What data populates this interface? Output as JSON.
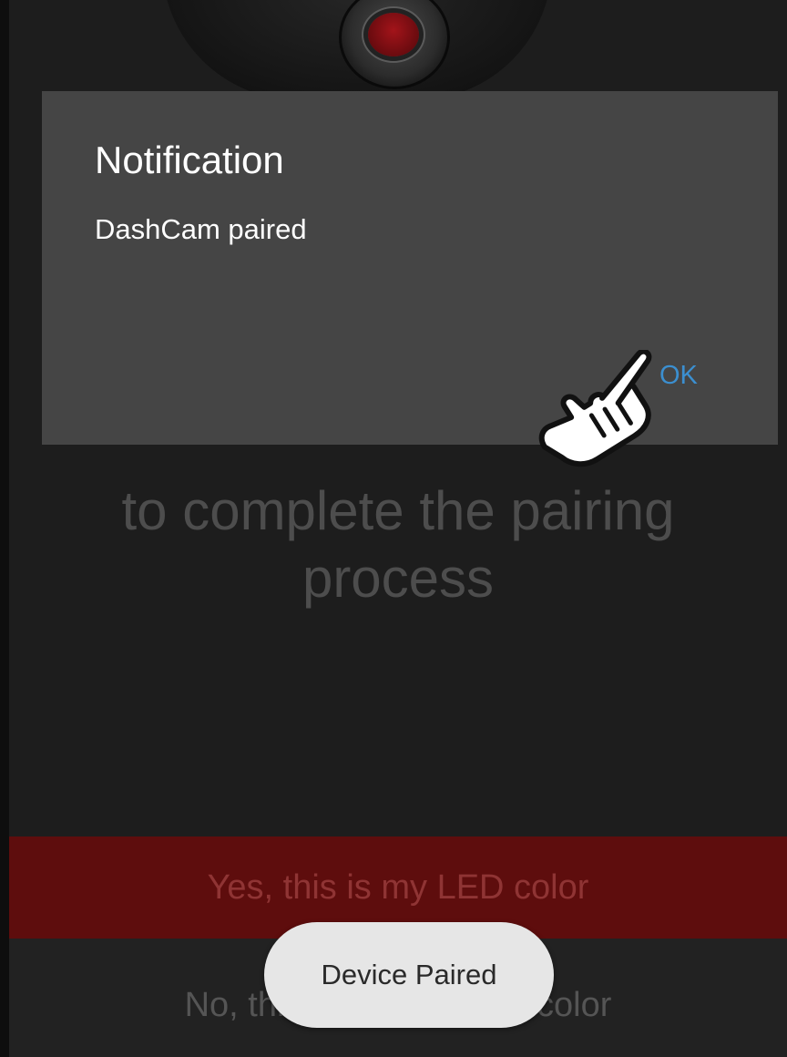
{
  "background": {
    "instruction_line1": "to complete the pairing",
    "instruction_line2": "process"
  },
  "dialog": {
    "title": "Notification",
    "message": "DashCam paired",
    "ok_label": "OK"
  },
  "buttons": {
    "yes_label": "Yes, this is my LED color",
    "no_label": "No, this is not my LED color"
  },
  "toast": {
    "text": "Device Paired"
  },
  "colors": {
    "led": "#a3141a",
    "accent": "#3b8fd0",
    "yes_button_bg": "#5e0d0d",
    "dialog_bg": "#454545"
  },
  "icons": {
    "cursor": "hand-pointer-icon"
  }
}
